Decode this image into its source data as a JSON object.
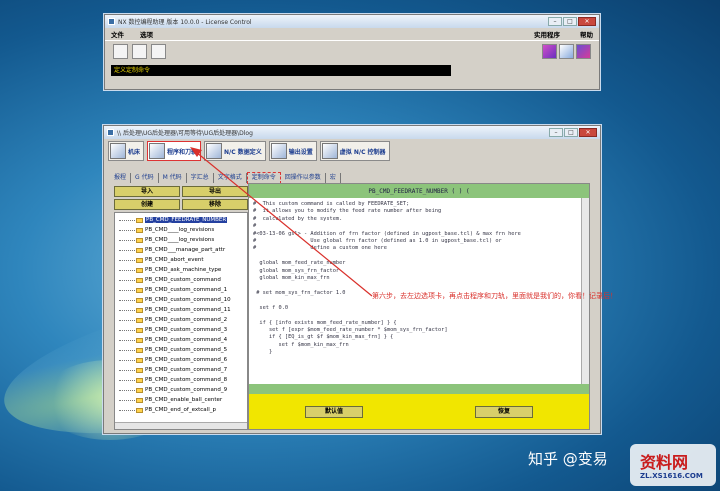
{
  "license_window": {
    "title": "NX 数控编程助理 版本 10.0.0 - License Control",
    "menu": [
      "文件",
      "选项"
    ],
    "menu_right": [
      "实用程序",
      "帮助"
    ],
    "status": "定义定制命令"
  },
  "main_window": {
    "title": "\\\\ 后处理\\UG后处理器\\可用等待\\UG后处理器\\Dlog",
    "big_tools": [
      "机床",
      "程序和刀轨",
      "N/C 数据定义",
      "输出设置",
      "虚拟 N/C 控制器"
    ],
    "sub_tabs": [
      "报程",
      "G 代码",
      "M 代码",
      "字汇总",
      "文字格式",
      "定制命令",
      "回操作以参数",
      "宏"
    ],
    "left_buttons": [
      "导入",
      "导出",
      "创建",
      "移除"
    ],
    "tree_items": [
      "PB_CMD_FEEDRATE_NUMBER",
      "PB_CMD____log_revisions",
      "PB_CMD____log_revisions",
      "PB_CMD___manage_part_attr",
      "PB_CMD_abort_event",
      "PB_CMD_ask_machine_type",
      "PB_CMD_custom_command",
      "PB_CMD_custom_command_1",
      "PB_CMD_custom_command_10",
      "PB_CMD_custom_command_11",
      "PB_CMD_custom_command_2",
      "PB_CMD_custom_command_3",
      "PB_CMD_custom_command_4",
      "PB_CMD_custom_command_5",
      "PB_CMD_custom_command_6",
      "PB_CMD_custom_command_7",
      "PB_CMD_custom_command_8",
      "PB_CMD_custom_command_9",
      "PB_CMD_enable_ball_center",
      "PB_CMD_end_of_extcall_p"
    ],
    "editor_header": "PB_CMD_FEEDRATE_NUMBER     ( )     (",
    "editor_code": "#  This custom command is called by FEEDRATE_SET;\n#  it allows you to modify the feed rate number after being\n#  calculated by the system.\n#\n#<03-13-06 gsl> - Addition of frn factor (defined in ugpost_base.tcl) & max frn here\n#                 Use global frn factor (defined as 1.0 in ugpost_base.tcl) or\n#                 define a custom one here\n\n  global mom_feed_rate_number\n  global mom_sys_frn_factor\n  global mom_kin_max_frn\n\n # set mom_sys_frn_factor 1.0\n\n  set f 0.0\n\n  if { [info exists mom_feed_rate_number] } {\n     set f [expr $mom_feed_rate_number * $mom_sys_frn_factor]\n     if { [EQ_is_gt $f $mom_kin_max_frn] } {\n        set f $mom_kin_max_frn\n     }",
    "footer_buttons": [
      "默认值",
      "恢复"
    ]
  },
  "annotation": "第六步，去左边选项卡，再点击程序和刀轨，里面就是我们的，你看！记录后！",
  "watermark": {
    "text": "知乎 @变易",
    "logo": "资料网",
    "url": "ZL.XS1616.COM"
  },
  "colors": {
    "accent_yellow": "#f1e600",
    "editor_green": "#8cc47b",
    "annotation_red": "#d9302b",
    "tool_label_blue": "#1a3b8e"
  }
}
